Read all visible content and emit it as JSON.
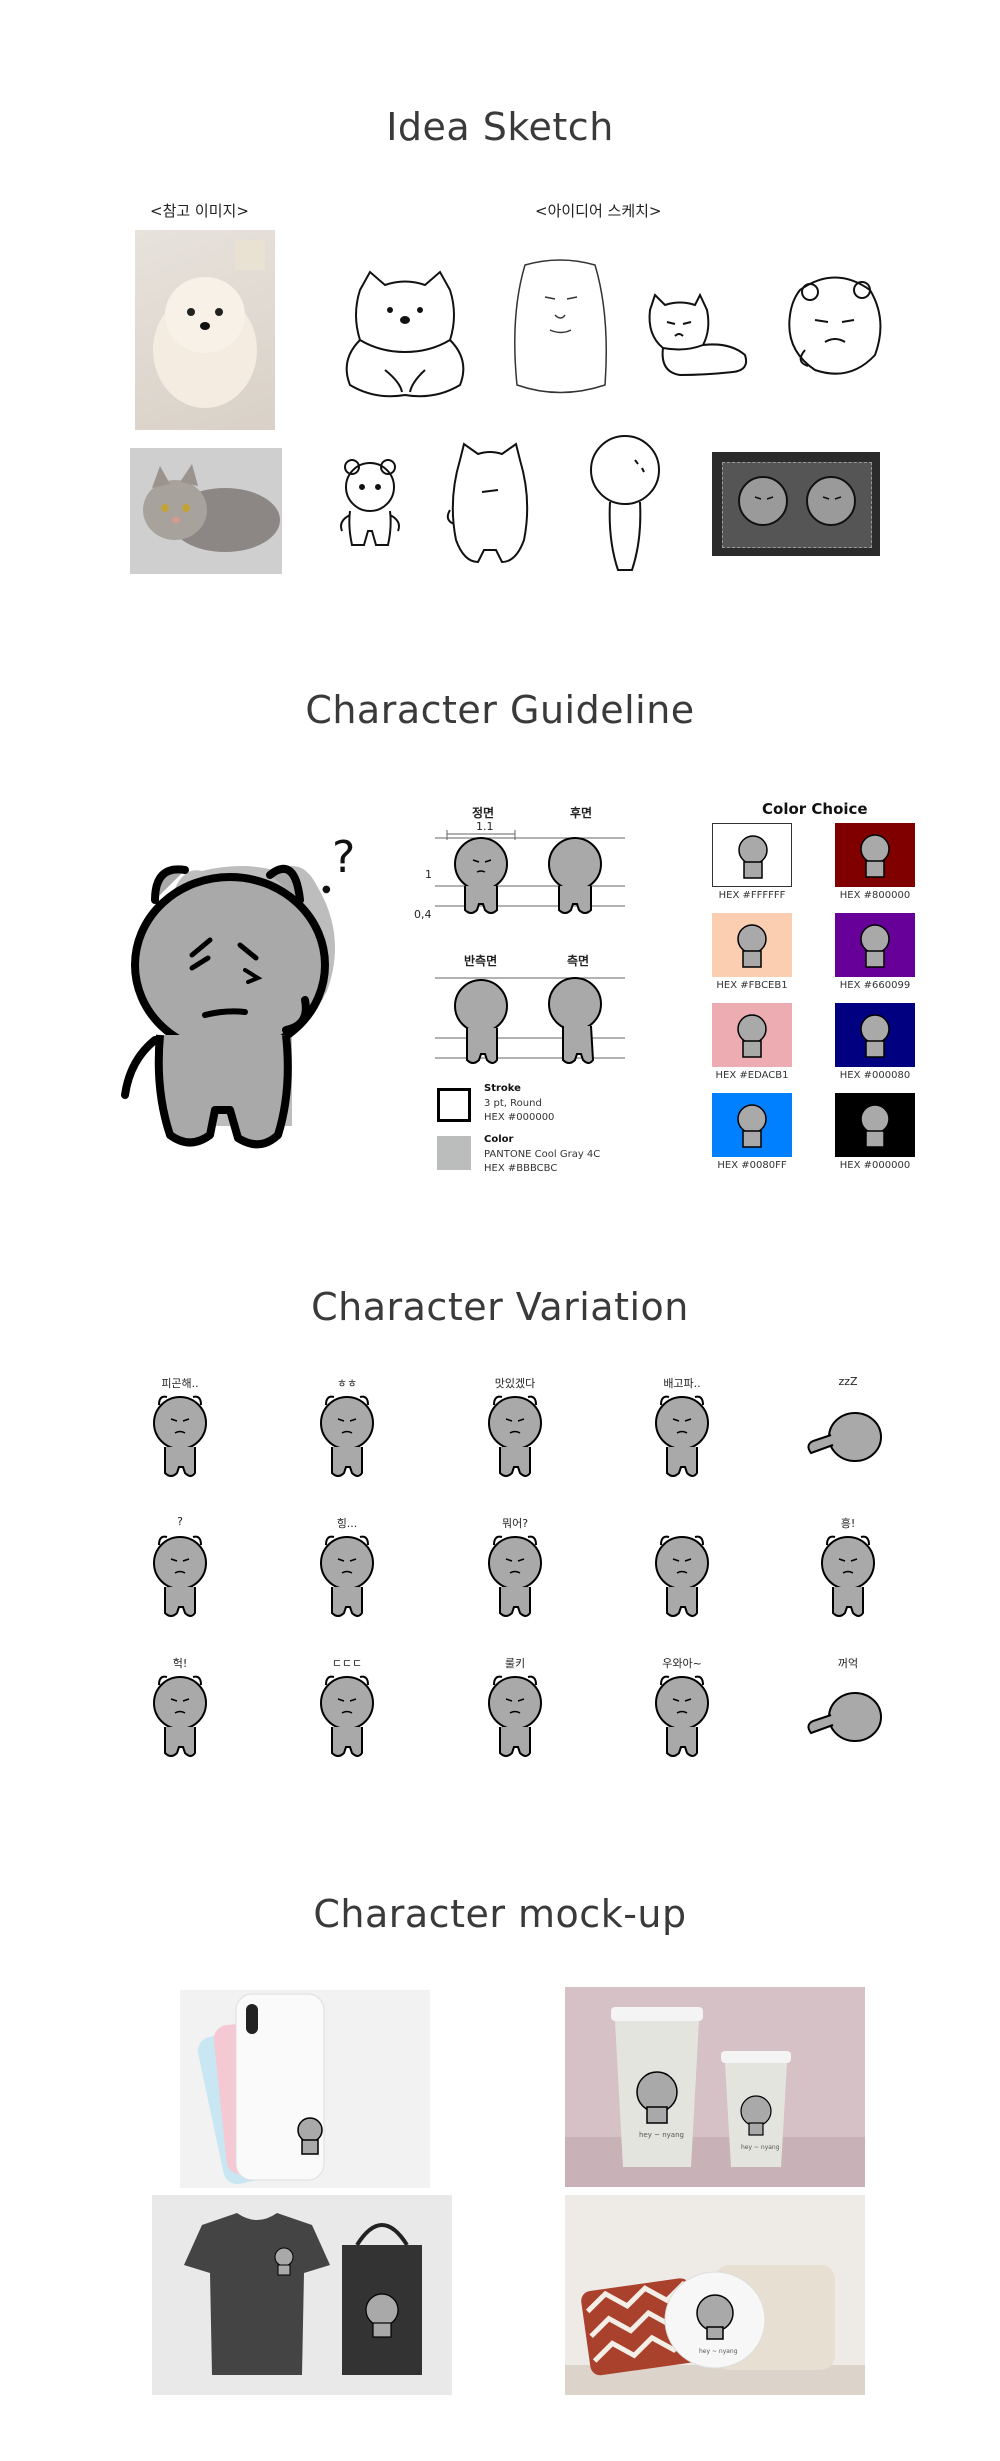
{
  "sections": {
    "idea": "Idea Sketch",
    "guideline": "Character Guideline",
    "variation": "Character Variation",
    "mockup": "Character mock-up"
  },
  "idea": {
    "ref_label": "<참고 이미지>",
    "sketch_label": "<아이디어 스케치>"
  },
  "guide": {
    "front": "정면",
    "back": "후면",
    "half_side": "반측면",
    "side": "측면",
    "ratio_top": "1.1",
    "ratio_1": "1",
    "ratio_2": "0,4",
    "stroke_title": "Stroke",
    "stroke_desc1": "3 pt, Round",
    "stroke_desc2": "HEX #000000",
    "color_title": "Color",
    "color_desc1": "PANTONE Cool Gray 4C",
    "color_desc2": "HEX #BBBCBC",
    "color_choice": "Color Choice",
    "swatches": [
      {
        "hex": "HEX #FFFFFF",
        "color": "#FFFFFF"
      },
      {
        "hex": "HEX #800000",
        "color": "#800000"
      },
      {
        "hex": "HEX #FBCEB1",
        "color": "#FBCEB1"
      },
      {
        "hex": "HEX #660099",
        "color": "#660099"
      },
      {
        "hex": "HEX #EDACB1",
        "color": "#EDACB1"
      },
      {
        "hex": "HEX #000080",
        "color": "#000080"
      },
      {
        "hex": "HEX #0080FF",
        "color": "#0080FF"
      },
      {
        "hex": "HEX #000000",
        "color": "#000000"
      }
    ]
  },
  "variations": [
    {
      "caption": "피곤해.."
    },
    {
      "caption": "ㅎㅎ"
    },
    {
      "caption": "맛있겠다"
    },
    {
      "caption": "배고파.."
    },
    {
      "caption": "zzZ"
    },
    {
      "caption": "?"
    },
    {
      "caption": "힝..."
    },
    {
      "caption": "뭐어?"
    },
    {
      "caption": ""
    },
    {
      "caption": "흥!"
    },
    {
      "caption": "헉!"
    },
    {
      "caption": "ㄷㄷㄷ"
    },
    {
      "caption": "룰키"
    },
    {
      "caption": "우와아~"
    },
    {
      "caption": "꺼억"
    }
  ],
  "mockup": {
    "cup_text": "hey ~ nyang"
  }
}
